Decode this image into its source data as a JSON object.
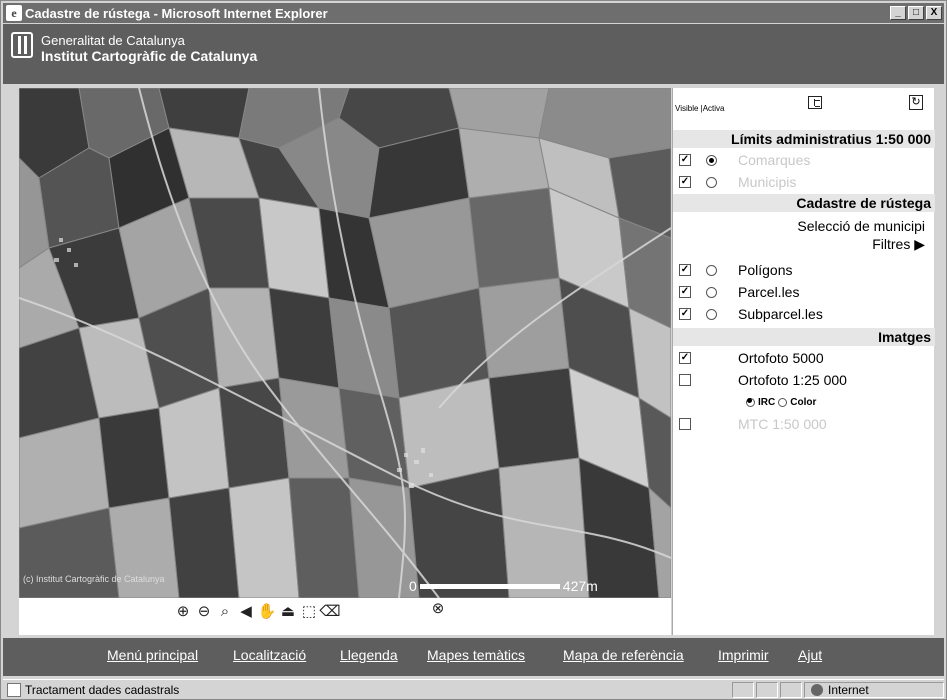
{
  "window": {
    "title": "Cadastre de rústega - Microsoft Internet Explorer",
    "minimize": "_",
    "maximize": "□",
    "close": "X"
  },
  "banner": {
    "org_line1": "Generalitat de Catalunya",
    "org_line2": "Institut Cartogràfic de Catalunya"
  },
  "map": {
    "copyright": "(c) Institut Cartogràfic de Catalunya",
    "scale_start": "0",
    "scale_end": "427m",
    "tools": [
      "zoom-in-icon",
      "zoom-out-icon",
      "zoom-window-icon",
      "previous-view-icon",
      "pan-hand-icon",
      "identify-icon",
      "select-icon",
      "eraser-icon"
    ],
    "extra_tool": "no-info-icon"
  },
  "panel": {
    "header_label": "Visible |Activa",
    "sections": {
      "limits": "Límits administratius 1:50 000",
      "cadastre": "Cadastre de rústega",
      "images": "Imatges"
    },
    "layers": {
      "comarques": {
        "label": "Comarques",
        "visible": true,
        "active": true
      },
      "municipis": {
        "label": "Municipis",
        "visible": true,
        "active": false
      },
      "poligons": {
        "label": "Polígons",
        "visible": true,
        "active": false
      },
      "parceles": {
        "label": "Parcel.les",
        "visible": true,
        "active": false
      },
      "subparceles": {
        "label": "Subparcel.les",
        "visible": true,
        "active": false
      },
      "ortofoto5000": {
        "label": "Ortofoto 5000",
        "visible": true
      },
      "ortofoto25000": {
        "label": "Ortofoto 1:25 000",
        "visible": false
      },
      "mtc": {
        "label": "MTC 1:50 000",
        "visible": false
      }
    },
    "selection_municipi": "Selecció de municipi",
    "filters": "Filtres ▶",
    "ortofoto_options": {
      "irc": "IRC",
      "color": "Color",
      "selected": "IRC"
    }
  },
  "nav": {
    "items": [
      "Menú principal",
      "Localització",
      "Llegenda",
      "Mapes temàtics",
      "Mapa de referència",
      "Imprimir",
      "Ajut"
    ]
  },
  "status": {
    "text": "Tractament dades cadastrals",
    "zone": "Internet"
  }
}
